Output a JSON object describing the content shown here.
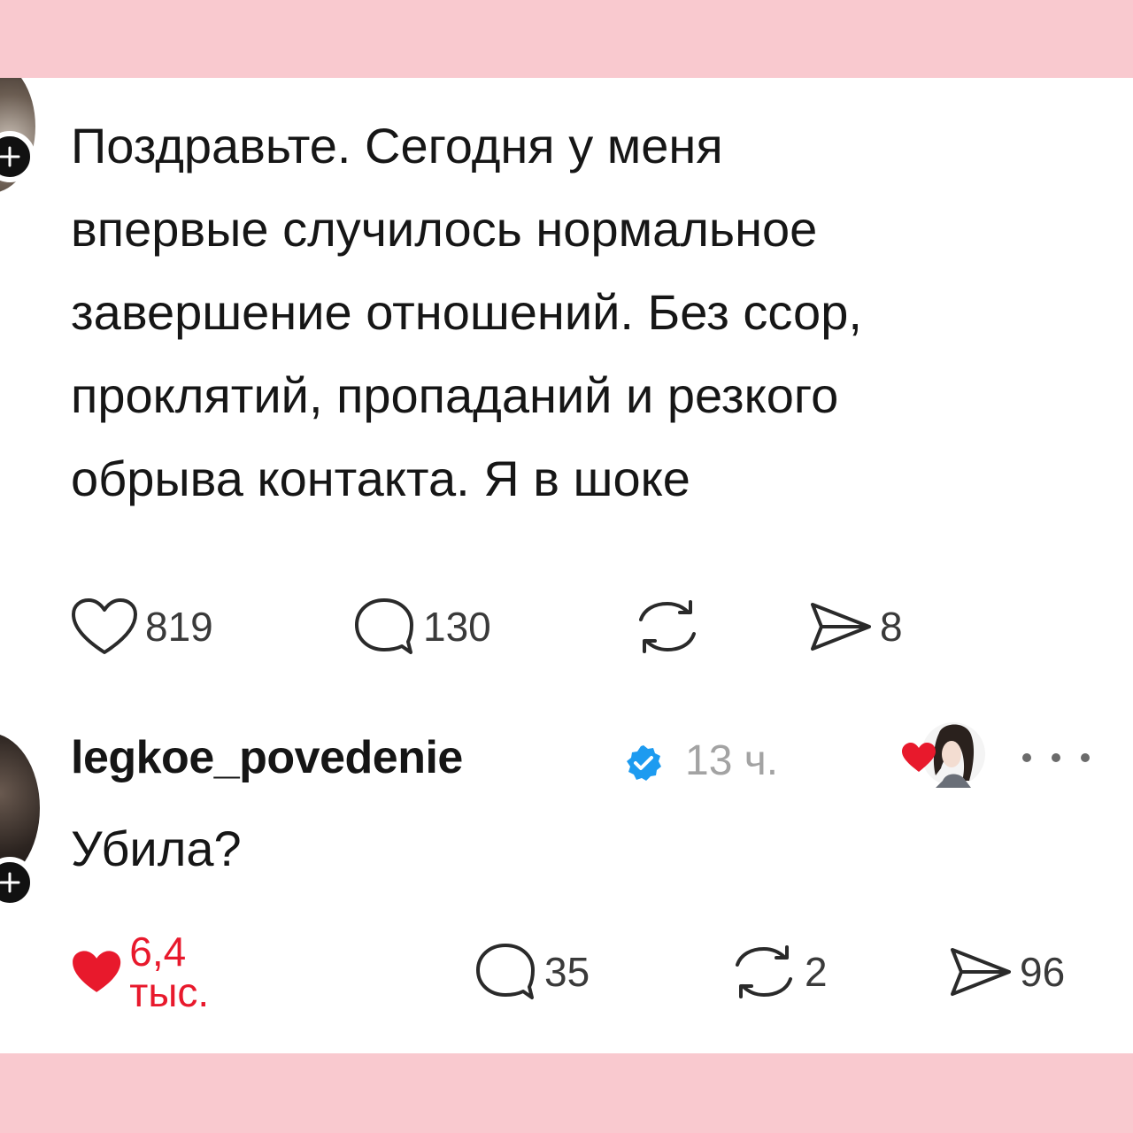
{
  "post": {
    "lines": [
      "Поздравьте. Сегодня у меня",
      "впервые случилось нормальное",
      "завершение отношений. Без ссор,",
      "проклятий, пропаданий и резкого",
      "обрыва контакта. Я в шоке"
    ],
    "likes": "819",
    "comments": "130",
    "reposts": "",
    "shares": "8"
  },
  "reply": {
    "username": "legkoe_povedenie",
    "verified": true,
    "time": "13 ч.",
    "text": "Убила?",
    "likes": "6,4 тыс.",
    "comments": "35",
    "reposts": "2",
    "shares": "96",
    "liked": true
  },
  "colors": {
    "frame": "#f9c9cf",
    "like_active": "#e8192c",
    "verified": "#1d9bf0",
    "muted": "#a3a3a3"
  },
  "icons": [
    "heart-icon",
    "comment-icon",
    "repost-icon",
    "share-icon",
    "verified-badge-icon",
    "more-icon",
    "plus-icon"
  ]
}
